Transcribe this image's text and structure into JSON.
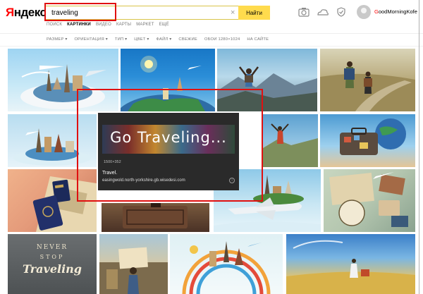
{
  "header": {
    "logo_first": "Я",
    "logo_rest": "ндекс",
    "search_value": "traveling",
    "search_clear": "×",
    "search_button": "Найти",
    "user_first": "G",
    "user_rest": "oodMorningKofe"
  },
  "tabs": [
    {
      "label": "ПОИСК",
      "active": false
    },
    {
      "label": "КАРТИНКИ",
      "active": true
    },
    {
      "label": "ВИДЕО",
      "active": false
    },
    {
      "label": "КАРТЫ",
      "active": false
    },
    {
      "label": "МАРКЕТ",
      "active": false
    },
    {
      "label": "ЕЩЁ",
      "active": false
    }
  ],
  "filters": [
    "РАЗМЕР ▾",
    "ОРИЕНТАЦИЯ ▾",
    "ТИП ▾",
    "ЦВЕТ ▾",
    "ФАЙЛ ▾",
    "СВЕЖИЕ",
    "ОБОИ 1280×1024",
    "НА САЙТЕ"
  ],
  "hover_card": {
    "image_text": "Go Traveling...",
    "dimensions": "1500×352",
    "title": "Travel.",
    "url": "easingwold.north-yorkshire.gb.wisedesi.com",
    "info_icon": "i"
  },
  "thumb_text": {
    "never": "NEVER",
    "stop": "STOP",
    "traveling": "Traveling"
  },
  "icons": [
    "camera-icon",
    "cloud-icon",
    "shield-icon",
    "avatar"
  ]
}
